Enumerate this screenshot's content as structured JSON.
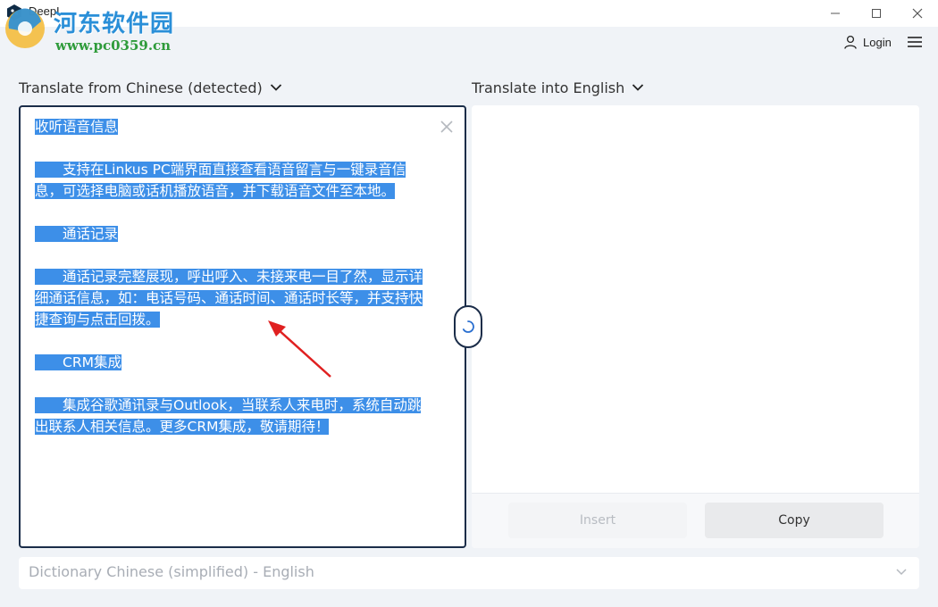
{
  "window": {
    "title": "DeepL"
  },
  "watermark": {
    "site_name": "河东软件园",
    "url": "www.pc0359.cn"
  },
  "header": {
    "login_label": "Login"
  },
  "source": {
    "language_label": "Translate from Chinese (detected)",
    "paragraphs": [
      [
        "收听语音信息"
      ],
      [
        "　　支持在Linkus PC端界面直接查看语音留言与一键录音信",
        "息，可选择电脑或话机播放语音，并下载语音文件至本地。"
      ],
      [
        "　　通话记录"
      ],
      [
        "　　通话记录完整展现，呼出呼入、未接来电一目了然，显示详",
        "细通话信息，如：电话号码、通话时间、通话时长等，并支持快",
        "捷查询与点击回拨。"
      ],
      [
        "　　CRM集成"
      ],
      [
        "　　集成谷歌通讯录与Outlook，当联系人来电时，系统自动跳",
        "出联系人相关信息。更多CRM集成，敬请期待！"
      ]
    ]
  },
  "target": {
    "language_label": "Translate into English",
    "insert_label": "Insert",
    "copy_label": "Copy"
  },
  "dictionary": {
    "label": "Dictionary Chinese (simplified) - English"
  },
  "colors": {
    "selection": "#3d8fe8",
    "panel_border": "#1b2d49",
    "annotation_arrow": "#e02020"
  }
}
